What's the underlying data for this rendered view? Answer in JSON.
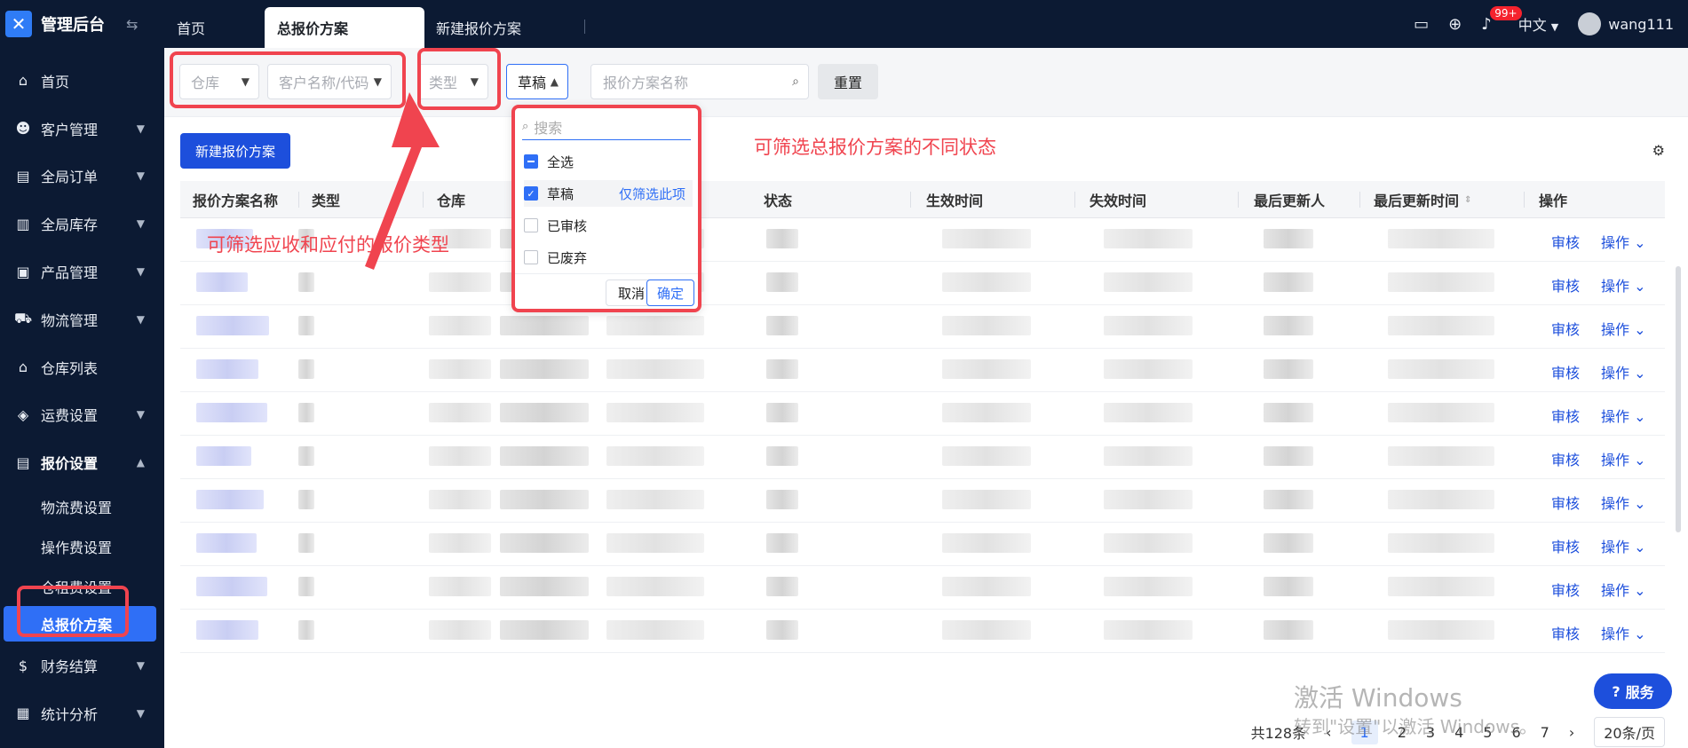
{
  "app": {
    "title": "管理后台",
    "collapse_icon": "toggle-arrows-icon"
  },
  "sidebar": {
    "items": [
      {
        "label": "首页",
        "icon": "home-icon"
      },
      {
        "label": "客户管理",
        "icon": "customers-icon"
      },
      {
        "label": "全局订单",
        "icon": "orders-icon"
      },
      {
        "label": "全局库存",
        "icon": "inventory-icon"
      },
      {
        "label": "产品管理",
        "icon": "products-icon"
      },
      {
        "label": "物流管理",
        "icon": "truck-icon"
      },
      {
        "label": "仓库列表",
        "icon": "warehouse-icon"
      },
      {
        "label": "运费设置",
        "icon": "shipping-fee-icon"
      },
      {
        "label": "报价设置",
        "icon": "quote-icon"
      },
      {
        "label": "财务结算",
        "icon": "finance-icon"
      },
      {
        "label": "统计分析",
        "icon": "stats-icon"
      }
    ],
    "sub_items": [
      {
        "label": "物流费设置"
      },
      {
        "label": "操作费设置"
      },
      {
        "label": "仓租费设置"
      },
      {
        "label": "总报价方案"
      }
    ]
  },
  "tabs": [
    {
      "label": "首页"
    },
    {
      "label": "总报价方案"
    },
    {
      "label": "新建报价方案"
    }
  ],
  "topbar": {
    "badge": "99+",
    "language": "中文",
    "username": "wang111"
  },
  "filters": {
    "warehouse_placeholder": "仓库",
    "customer_placeholder": "客户名称/代码",
    "type_placeholder": "类型",
    "status_value": "草稿",
    "name_placeholder": "报价方案名称",
    "reset_label": "重置"
  },
  "actions": {
    "new_button": "新建报价方案"
  },
  "table": {
    "headers": [
      "报价方案名称",
      "类型",
      "仓库",
      "状态",
      "生效时间",
      "失效时间",
      "最后更新人",
      "最后更新时间",
      "操作"
    ],
    "row_actions": {
      "review": "审核",
      "more": "操作"
    }
  },
  "dropdown": {
    "search_placeholder": "搜索",
    "options": [
      {
        "label": "全选",
        "state": "indeterminate"
      },
      {
        "label": "草稿",
        "state": "checked",
        "only_link": "仅筛选此项"
      },
      {
        "label": "已审核",
        "state": "unchecked"
      },
      {
        "label": "已废弃",
        "state": "unchecked"
      }
    ],
    "cancel_label": "取消",
    "confirm_label": "确定"
  },
  "annotations": {
    "status_note": "可筛选总报价方案的不同状态",
    "type_note": "可筛选应收和应付的报价类型"
  },
  "pagination": {
    "total": "共128条",
    "pages": [
      "1",
      "2",
      "3",
      "4",
      "5",
      "6",
      "7"
    ],
    "current": "1",
    "page_size": "20条/页"
  },
  "watermark": {
    "line1": "激活 Windows",
    "line2": "转到\"设置\"以激活 Windows。"
  },
  "service_button": "服务",
  "colors": {
    "sidebar_bg": "#0c1a33",
    "primary": "#1d4fdc",
    "annotation_red": "#f0444f"
  }
}
